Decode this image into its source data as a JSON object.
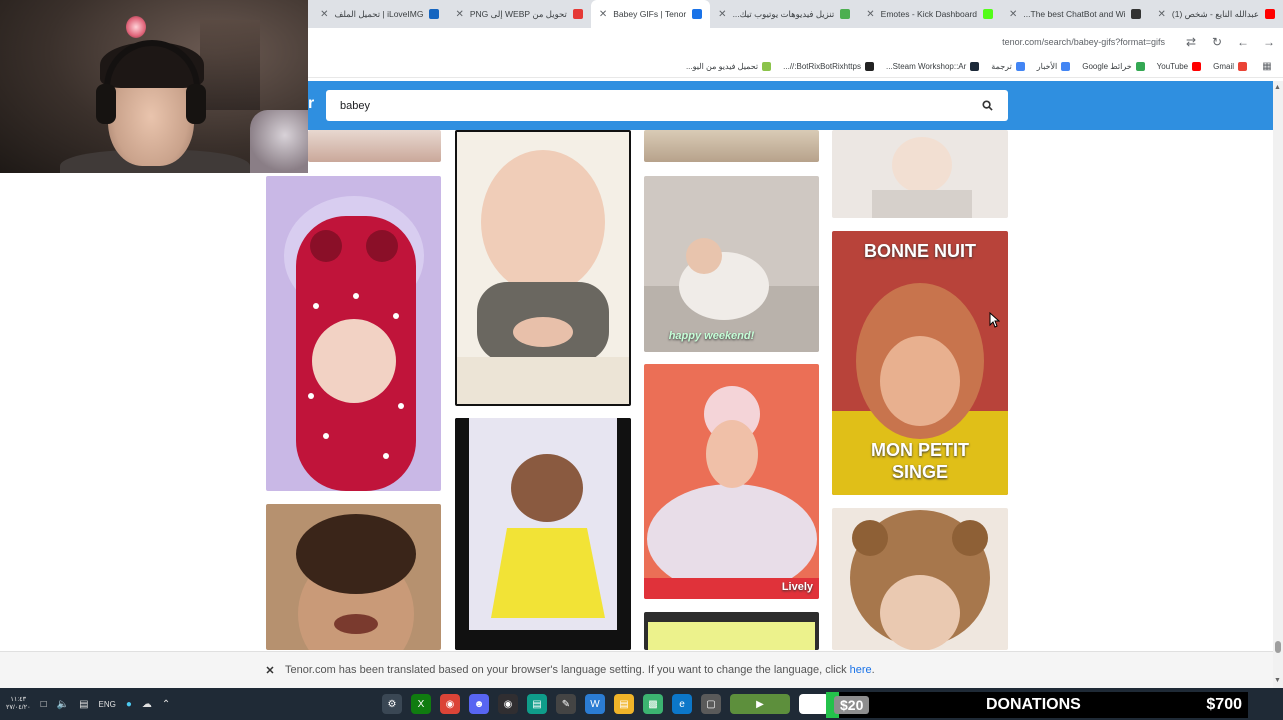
{
  "browser": {
    "tabs": [
      {
        "label": "عبدالله النايع - شخص (1)",
        "favicon_color": "#ff0000",
        "active": false
      },
      {
        "label": "The best ChatBot and Wi...",
        "favicon_color": "#333333",
        "active": false
      },
      {
        "label": "Emotes - Kick Dashboard",
        "favicon_color": "#53fc18",
        "active": false
      },
      {
        "label": "تنزيل فيديوهات يوتيوب تيك...",
        "favicon_color": "#4caf50",
        "active": false
      },
      {
        "label": "Babey GIFs | Tenor",
        "favicon_color": "#1a73e8",
        "active": true
      },
      {
        "label": "تحويل من WEBP إلى PNG",
        "favicon_color": "#e53935",
        "active": false
      },
      {
        "label": "iLoveIMG | تحميل الملف",
        "favicon_color": "#1565c0",
        "active": false
      }
    ],
    "url": "tenor.com/search/babey-gifs?format=gifs",
    "bookmarks": [
      {
        "label": "Gmail",
        "icon_color": "#ea4335"
      },
      {
        "label": "YouTube",
        "icon_color": "#ff0000"
      },
      {
        "label": "خرائط Google",
        "icon_color": "#34a853"
      },
      {
        "label": "الأخبار",
        "icon_color": "#4285f4"
      },
      {
        "label": "ترجمة",
        "icon_color": "#4285f4"
      },
      {
        "label": "Steam Workshop::Ar...",
        "icon_color": "#1b2838"
      },
      {
        "label": "BotRixBotRixhttps://...",
        "icon_color": "#222222"
      },
      {
        "label": "تحميل فيديو من اليو...",
        "icon_color": "#8bc34a"
      }
    ]
  },
  "tenor": {
    "logo_partial": "r",
    "search_value": "babey",
    "accent": "#2f8fe0",
    "gifs": [
      {
        "id": "g1",
        "caption": "",
        "palette": [
          "#e8d8d0",
          "#caa89a"
        ]
      },
      {
        "id": "g2",
        "caption": "",
        "palette": [
          "#f1ece4",
          "#b89f8a"
        ]
      },
      {
        "id": "g3",
        "caption": "",
        "palette": [
          "#d9cbb6",
          "#b7a28b"
        ]
      },
      {
        "id": "g4",
        "caption": "",
        "palette": [
          "#ece7e3",
          "#b9aea6"
        ]
      },
      {
        "id": "g5",
        "caption": "",
        "palette": [
          "#c9b8e6",
          "#c0143a"
        ]
      },
      {
        "id": "g6",
        "caption": "",
        "palette": [
          "#efe7df",
          "#5d5248"
        ]
      },
      {
        "id": "g7",
        "caption": "happy weekend!",
        "palette": [
          "#cfc8c2",
          "#f0ece8"
        ]
      },
      {
        "id": "g8",
        "caption_top": "BONNE NUIT",
        "caption_bottom": "MON PETIT SINGE",
        "palette": [
          "#b8433a",
          "#e0bf18"
        ]
      },
      {
        "id": "g9",
        "caption": "",
        "palette": [
          "#f3e4e9",
          "#e2cde8"
        ]
      },
      {
        "id": "g10",
        "caption": "",
        "palette": [
          "#e7e5f1",
          "#f2e336"
        ]
      },
      {
        "id": "g11",
        "caption": "Lively",
        "palette": [
          "#eb6f56",
          "#e8dde8"
        ]
      },
      {
        "id": "g12",
        "caption": "",
        "palette": [
          "#b6916f",
          "#6e4a30"
        ]
      },
      {
        "id": "g13",
        "caption": "",
        "palette": [
          "#ecf28c",
          "#2d2d2d"
        ]
      }
    ]
  },
  "translate_banner": {
    "message": "Tenor.com has been translated based on your browser's language setting. If you want to change the language, click",
    "link": "here",
    "suffix": "."
  },
  "taskbar": {
    "time": "١١:٤٣",
    "date": "٢٧/٠٤/٢٠",
    "language": "ENG"
  },
  "donations": {
    "current": "$20",
    "label": "DONATIONS",
    "goal": "$700",
    "progress_fraction": 0.03,
    "bar_color": "#24c24b"
  }
}
